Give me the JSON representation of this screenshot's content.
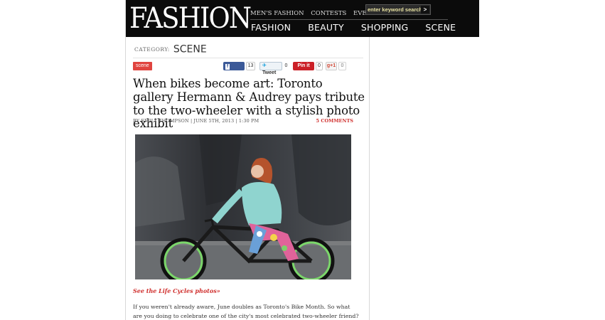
{
  "header": {
    "logo": "FASHION",
    "util_nav": [
      "MEN'S FASHION",
      "CONTESTS",
      "EVENTS"
    ],
    "search": {
      "placeholder": "enter keyword search",
      "button": ">"
    },
    "main_nav": [
      "FASHION",
      "BEAUTY",
      "SHOPPING",
      "SCENE"
    ]
  },
  "category": {
    "label": "CATEGORY:",
    "value": "SCENE"
  },
  "tag": "scene",
  "social": {
    "facebook": {
      "label": "Share",
      "count": "13"
    },
    "twitter": {
      "label": "Tweet",
      "count": "0"
    },
    "pinterest": {
      "label": "Pin it",
      "count": "0"
    },
    "gplus": {
      "label": "g+1",
      "count": "0"
    }
  },
  "article": {
    "headline": "When bikes become art: Toronto gallery Hermann & Audrey pays tribute to the two-wheeler with a stylish photo exhibit",
    "byline": "BY EMILY THOMPSON | JUNE 5TH, 2013 | 1:30 PM",
    "comments": "5 COMMENTS",
    "gallery_link": "See the Life Cycles photos»",
    "body": "If you weren't already aware, June doubles as Toronto's Bike Month. So what are you doing to celebrate one of the city's most celebrated two-wheeler friend?"
  },
  "icons": {
    "search_button": "arrow-right-icon",
    "facebook": "facebook-icon",
    "twitter": "twitter-bird-icon"
  },
  "colors": {
    "masthead": "#0b0b0b",
    "accent_red": "#d0302e",
    "facebook_blue": "#3b5998",
    "pinterest_red": "#cb2027",
    "search_text": "#e6e0a0"
  }
}
